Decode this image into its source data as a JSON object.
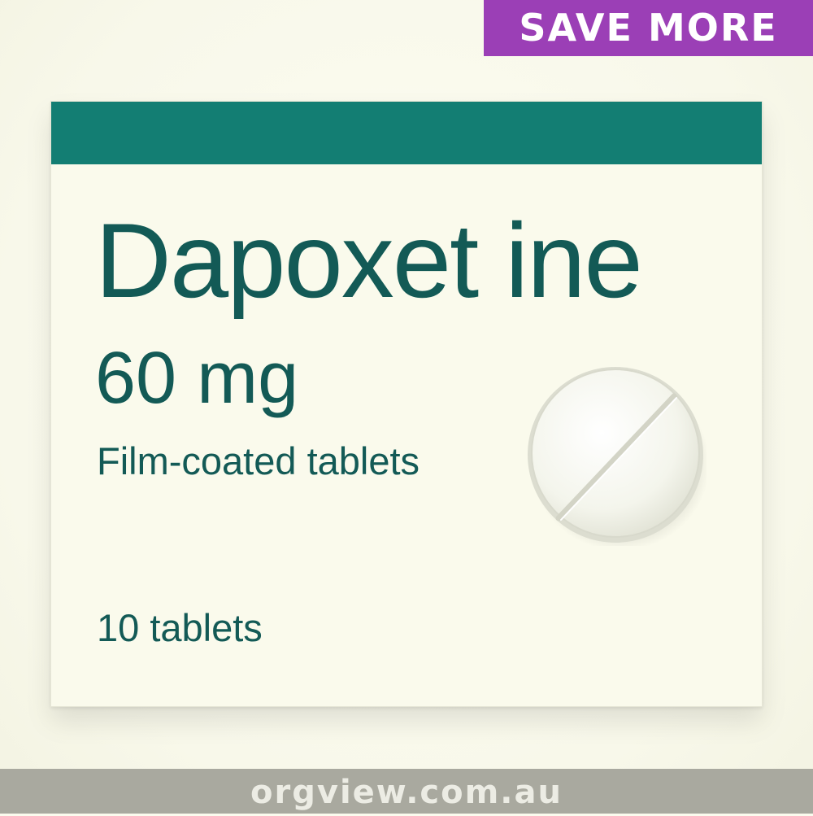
{
  "badge": {
    "label": "SAVE MORE",
    "color": "#9b3fb6"
  },
  "package": {
    "band_color": "#137e73",
    "text_color": "#135a56",
    "product_name": "Dapoxet ine",
    "strength": "60 mg",
    "dosage_form": "Film-coated tablets",
    "pack_count": "10 tablets"
  },
  "footer": {
    "watermark": "orgview.com.au"
  }
}
